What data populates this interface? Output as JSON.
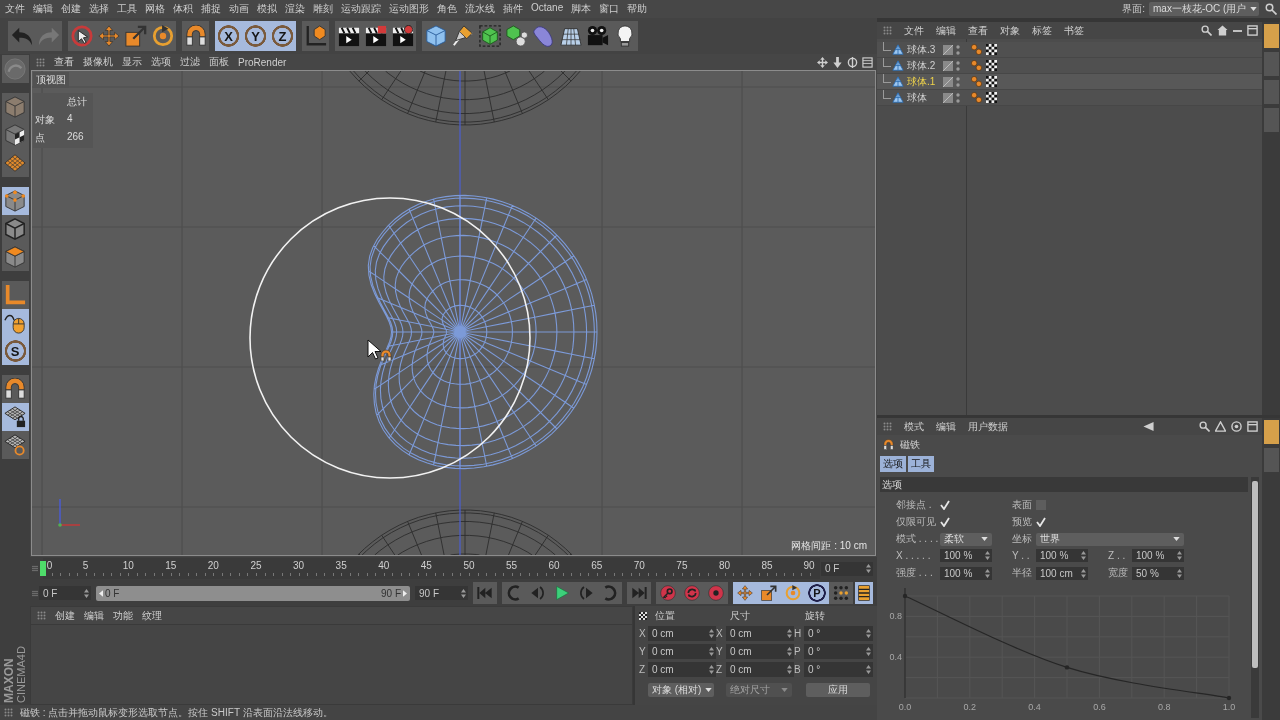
{
  "menu_bar": {
    "items": [
      "文件",
      "编辑",
      "创建",
      "选择",
      "工具",
      "网格",
      "体积",
      "捕捉",
      "动画",
      "模拟",
      "渲染",
      "雕刻",
      "运动跟踪",
      "运动图形",
      "角色",
      "流水线",
      "插件",
      "Octane",
      "脚本",
      "窗口",
      "帮助"
    ],
    "layout_label": "界面:",
    "layout_value": "max一枝花-OC (用户"
  },
  "toolbar": {
    "groups": [
      [
        {
          "kind": "undo"
        },
        {
          "kind": "redo"
        }
      ],
      [
        {
          "kind": "live-select"
        },
        {
          "kind": "move"
        },
        {
          "kind": "scale"
        },
        {
          "kind": "rotate"
        }
      ],
      [
        {
          "kind": "magnet"
        }
      ],
      [
        {
          "kind": "axis-lock",
          "label": "X",
          "selected": true
        },
        {
          "kind": "axis-lock",
          "label": "Y",
          "selected": true
        },
        {
          "kind": "axis-lock",
          "label": "Z",
          "selected": true
        }
      ],
      [
        {
          "kind": "coords"
        }
      ],
      [
        {
          "kind": "render-view"
        },
        {
          "kind": "render-picture"
        },
        {
          "kind": "render-settings"
        }
      ],
      [
        {
          "kind": "cube"
        },
        {
          "kind": "pen"
        },
        {
          "kind": "subdivide"
        },
        {
          "kind": "cloner"
        },
        {
          "kind": "deformer"
        },
        {
          "kind": "floor"
        },
        {
          "kind": "camera"
        },
        {
          "kind": "light"
        }
      ]
    ]
  },
  "left_tools": [
    [
      {
        "kind": "convert",
        "selected": false
      }
    ],
    [
      {
        "kind": "model",
        "selected": false
      },
      {
        "kind": "texture",
        "selected": false
      },
      {
        "kind": "workplane",
        "selected": false
      }
    ],
    [
      {
        "kind": "points",
        "selected": true
      },
      {
        "kind": "edges",
        "selected": false
      },
      {
        "kind": "polygons",
        "selected": false
      }
    ],
    [
      {
        "kind": "axis",
        "selected": false
      },
      {
        "kind": "tweak",
        "selected": true
      },
      {
        "kind": "snap",
        "label": "S",
        "selected": true
      }
    ],
    [
      {
        "kind": "magnet",
        "selected": false
      },
      {
        "kind": "grid-lock",
        "selected": true
      },
      {
        "kind": "grid-snap",
        "selected": false
      }
    ]
  ],
  "logo": {
    "brand": "MAXON",
    "product": "CINEMA4D"
  },
  "viewport": {
    "menu": [
      "查看",
      "摄像机",
      "显示",
      "选项",
      "过滤",
      "面板",
      "ProRender"
    ],
    "title": "顶视图",
    "hud": {
      "heading": "总计",
      "rows": [
        {
          "label": "对象",
          "value": "4"
        },
        {
          "label": "点",
          "value": "266"
        }
      ]
    },
    "grid_spacing": "网格间距 : 10 cm"
  },
  "timeline": {
    "ticks": [
      "0",
      "5",
      "10",
      "15",
      "20",
      "25",
      "30",
      "35",
      "40",
      "45",
      "50",
      "55",
      "60",
      "65",
      "70",
      "75",
      "80",
      "85",
      "90"
    ],
    "playhead": {
      "level": 0
    },
    "current_frame": "0 F",
    "start_field": "0 F",
    "range": {
      "start": "0 F",
      "end": "90 F",
      "level": 1
    },
    "end_field": "90 F",
    "transport": [
      [
        {
          "kind": "go-start"
        }
      ],
      [
        {
          "kind": "prev-key"
        },
        {
          "kind": "step-back"
        },
        {
          "kind": "play"
        },
        {
          "kind": "step-forward"
        },
        {
          "kind": "next-key"
        }
      ],
      [
        {
          "kind": "go-end"
        }
      ]
    ],
    "record": [
      {
        "kind": "record-key"
      },
      {
        "kind": "auto-key"
      },
      {
        "kind": "key-select"
      }
    ],
    "key_modes": [
      {
        "kind": "move",
        "selected": true
      },
      {
        "kind": "scale",
        "selected": true
      },
      {
        "kind": "rotate",
        "selected": true
      },
      {
        "kind": "param",
        "label": "P",
        "selected": true
      },
      {
        "kind": "point-level",
        "selected": false
      }
    ],
    "extra": [
      {
        "kind": "timeline",
        "selected": true
      }
    ]
  },
  "material_manager": {
    "menu": [
      "创建",
      "编辑",
      "功能",
      "纹理"
    ]
  },
  "coordinates": {
    "headers": [
      "位置",
      "尺寸",
      "旋转"
    ],
    "rows": [
      {
        "position_axis": "X",
        "position": "0 cm",
        "size_axis": "X",
        "size": "0 cm",
        "rotation_axis": "H",
        "rotation": "0 °"
      },
      {
        "position_axis": "Y",
        "position": "0 cm",
        "size_axis": "Y",
        "size": "0 cm",
        "rotation_axis": "P",
        "rotation": "0 °"
      },
      {
        "position_axis": "Z",
        "position": "0 cm",
        "size_axis": "Z",
        "size": "0 cm",
        "rotation_axis": "B",
        "rotation": "0 °"
      }
    ],
    "mode": "对象 (相对)",
    "size_mode": {
      "value": "绝对尺寸",
      "disabled": true
    },
    "apply": "应用"
  },
  "status_bar": "磁铁 : 点击并拖动鼠标变形选取节点。按住 SHIFT 沿表面沿法线移动。",
  "object_manager": {
    "menu": [
      "文件",
      "编辑",
      "查看",
      "对象",
      "标签",
      "书签"
    ],
    "objects": [
      {
        "name": "球体.3",
        "selected": false,
        "tags": [
          {
            "kind": "phong"
          },
          {
            "kind": "material"
          }
        ]
      },
      {
        "name": "球体.2",
        "selected": false,
        "tags": [
          {
            "kind": "phong"
          },
          {
            "kind": "material"
          }
        ]
      },
      {
        "name": "球体.1",
        "selected": true,
        "tags": [
          {
            "kind": "phong"
          },
          {
            "kind": "material"
          }
        ]
      },
      {
        "name": "球体",
        "selected": false,
        "tags": [
          {
            "kind": "phong"
          },
          {
            "kind": "material"
          }
        ]
      }
    ],
    "side_tabs": [
      {
        "selected": true
      },
      {
        "selected": false
      },
      {
        "selected": false
      },
      {
        "selected": false
      }
    ]
  },
  "attribute_manager": {
    "menu": [
      "模式",
      "编辑",
      "用户数据"
    ],
    "tool": "磁铁",
    "tabs": [
      {
        "label": "选项",
        "selected": true
      },
      {
        "label": "工具",
        "selected": true
      }
    ],
    "section": "选项",
    "rows": [
      [
        {
          "kind": "check",
          "label": "邻接点 .",
          "checked": true
        },
        {
          "kind": "check",
          "label": "表面",
          "checked": false
        }
      ],
      [
        {
          "kind": "check",
          "label": "仅限可见",
          "checked": true
        },
        {
          "kind": "check",
          "label": "预览",
          "checked": true
        }
      ],
      [
        {
          "kind": "dropdown",
          "label": "模式 . . . .",
          "value": "柔软"
        },
        {
          "kind": "dropdown",
          "label": "坐标",
          "value": "世界"
        }
      ],
      [
        {
          "kind": "number",
          "label": "X . . . . .",
          "value": "100 %"
        },
        {
          "kind": "number",
          "label": "Y . .",
          "value": "100 %"
        },
        {
          "kind": "number",
          "label": "Z . .",
          "value": "100 %"
        }
      ],
      [
        {
          "kind": "number",
          "label": "强度 . . .",
          "value": "100 %"
        },
        {
          "kind": "number",
          "label": "半径",
          "value": "100 cm"
        },
        {
          "kind": "number",
          "label": "宽度",
          "value": "50 %"
        }
      ]
    ],
    "chart_data": {
      "type": "line",
      "x": [
        0,
        0.5,
        1
      ],
      "values": [
        1,
        0.3,
        0
      ],
      "xlim": [
        0,
        1
      ],
      "ylim": [
        0,
        1
      ],
      "xticks": [
        {
          "value": 0,
          "label": "0.0"
        },
        0.2,
        0.4,
        0.6,
        0.8,
        {
          "value": 1,
          "label": "1.0"
        }
      ],
      "yticks": [
        0.4,
        0.8
      ],
      "grid": true
    },
    "side_tabs": [
      {
        "selected": true
      },
      {
        "selected": false
      }
    ]
  }
}
